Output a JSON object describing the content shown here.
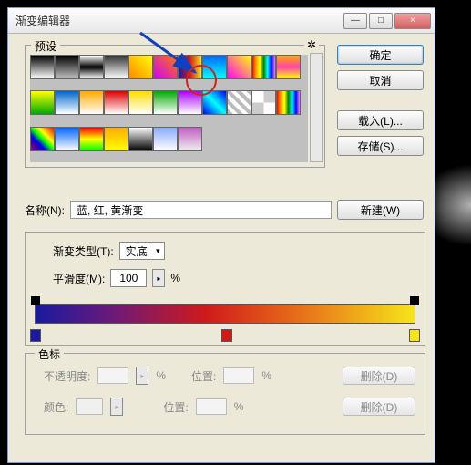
{
  "window": {
    "title": "渐变编辑器",
    "min": "—",
    "max": "□",
    "close": "×"
  },
  "presets": {
    "label": "预设"
  },
  "buttons": {
    "ok": "确定",
    "cancel": "取消",
    "load": "载入(L)...",
    "save": "存储(S)...",
    "new": "新建(W)"
  },
  "name": {
    "label": "名称(N):",
    "value": "蓝, 红, 黄渐变"
  },
  "gradient": {
    "type_label": "渐变类型(T):",
    "type_value": "实底",
    "smooth_label": "平滑度(M):",
    "smooth_value": "100",
    "percent": "%"
  },
  "stops": {
    "group_label": "色标",
    "opacity_label": "不透明度:",
    "pos_label": "位置:",
    "color_label": "颜色:",
    "delete": "删除(D)",
    "percent": "%"
  },
  "swatches": [
    "linear-gradient(#000,#fff)",
    "linear-gradient(#000,transparent)",
    "linear-gradient(#fff,#000,#fff)",
    "linear-gradient(#333,#fff)",
    "linear-gradient(45deg,#f80,#ff0)",
    "linear-gradient(45deg,#d000ff,#ff7a00)",
    "linear-gradient(to right,#1a1aa0,#d01a1a,#f5e51a)",
    "linear-gradient(#06f,#0ff)",
    "linear-gradient(45deg,#f0f,#ff0)",
    "linear-gradient(to right,red,orange,yellow,green,cyan,blue,violet)",
    "linear-gradient(#fa0,#f4a,#ff0)",
    "linear-gradient(#ff0,#0a0)",
    "linear-gradient(#06c,#fff)",
    "linear-gradient(#fa0,#fff)",
    "linear-gradient(#d00,#fff)",
    "linear-gradient(#fd0,#fff)",
    "linear-gradient(#0a0,#fff)",
    "linear-gradient(#a0f,#fff)",
    "linear-gradient(45deg,#00f,#0ff,#00f)",
    "repeating-linear-gradient(45deg,#bbb 0 4px,#fff 4px 8px)",
    "repeating-conic-gradient(#ccc 0 25%,#fff 0 50%)",
    "linear-gradient(to right,red,orange,yellow,green,cyan,blue,violet)",
    "linear-gradient(45deg,#9400d3,#4b0082,#0000ff,#00ff00,#ffff00,#ff7f00,#ff0000)",
    "linear-gradient(#06f,#fff)",
    "linear-gradient(#f00,#ff0,#0f0)",
    "linear-gradient(#fa0,#ff0)",
    "linear-gradient(#fff,#000)",
    "linear-gradient(#8af,#fff)",
    "linear-gradient(#c060c0,#eee)"
  ]
}
